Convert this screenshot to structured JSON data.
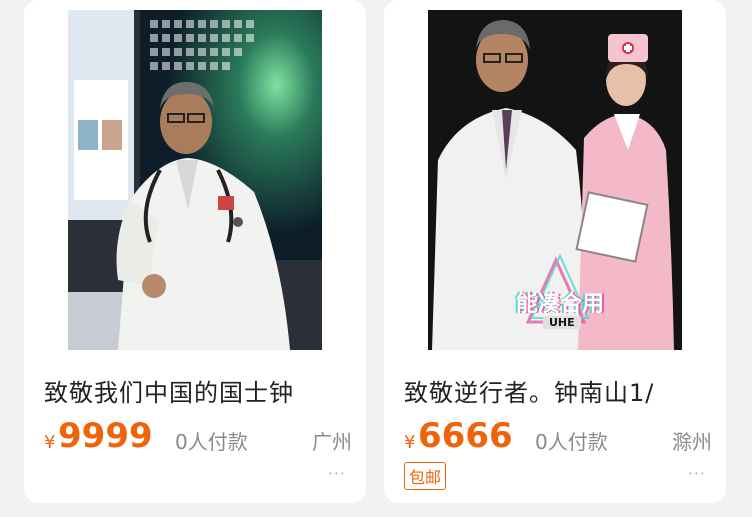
{
  "products": [
    {
      "title": "致敬我们中国的国士钟",
      "currency": "¥",
      "price": "9999",
      "paid": "0人付款",
      "location": "广州",
      "more": "···"
    },
    {
      "title": "致敬逆行者。钟南山1/",
      "currency": "¥",
      "price": "6666",
      "paid": "0人付款",
      "location": "滁州",
      "more": "···",
      "badge": "包邮",
      "watermark": "能凑合用",
      "watermark_sub": "UHE"
    }
  ],
  "colors": {
    "accent": "#f0630a",
    "muted": "#8a8a8a"
  }
}
